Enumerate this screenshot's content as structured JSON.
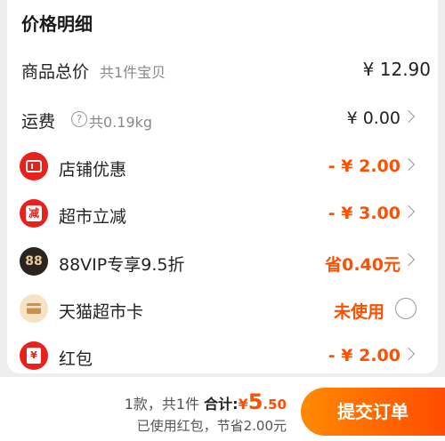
{
  "section_title": "价格明细",
  "rows": {
    "goods_total": {
      "label": "商品总价",
      "sub": "共1件宝贝",
      "value": "¥ 12.90"
    },
    "shipping": {
      "label": "运费",
      "help": "?",
      "sub": "共0.19kg",
      "value": "¥ 0.00"
    },
    "shop_discount": {
      "label": "店铺优惠",
      "value": "- ¥ 2.00"
    },
    "market_discount": {
      "label": "超市立减",
      "icon_text": "减",
      "value": "- ¥ 3.00"
    },
    "vip": {
      "label": "88VIP专享9.5折",
      "icon_text": "88",
      "value": "省0.40元"
    },
    "tmall_card": {
      "label": "天猫超市卡",
      "value": "未使用"
    },
    "red_packet": {
      "label": "红包",
      "icon_text": "¥",
      "value": "- ¥ 2.00"
    }
  },
  "footer": {
    "count": "1款，共1件",
    "total_label": "合计:",
    "currency": "¥",
    "total_int": "5",
    "total_dec": ".50",
    "saving_note": "已使用红包，节省2.00元",
    "submit_label": "提交订单"
  },
  "colors": {
    "accent": "#ff5000",
    "background": "#eeeeee"
  }
}
